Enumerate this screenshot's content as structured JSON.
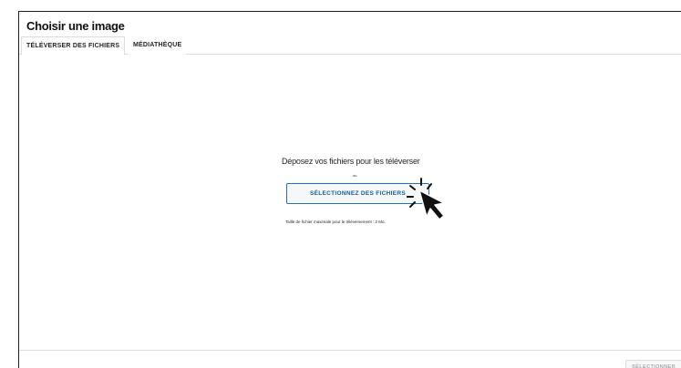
{
  "modal": {
    "title": "Choisir une image",
    "tabs": [
      {
        "label": "TÉLÉVERSER DES FICHIERS",
        "active": true
      },
      {
        "label": "MÉDIATHÈQUE",
        "active": false
      }
    ]
  },
  "uploader": {
    "drop_text": "Déposez vos fichiers pour les téléverser",
    "or_text": "ou",
    "select_button": "SÉLECTIONNEZ DES FICHIERS",
    "max_size": "Taille de fichier maximale pour le téléversement : 2 Mo."
  },
  "footer": {
    "select_button": "SÉLECTIONNER"
  },
  "colors": {
    "accent": "#2271b1",
    "button_text": "#135e96",
    "border": "#dcdcde"
  }
}
